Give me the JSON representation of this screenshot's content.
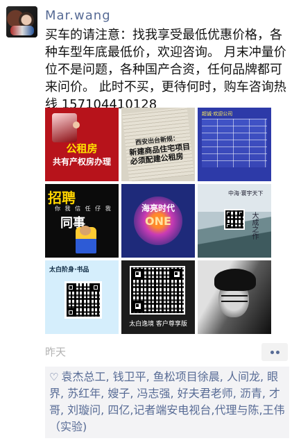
{
  "post": {
    "username": "Mar.wang",
    "content": "买车的请注意：找我享受最低优惠价格，各种车型年底最低价，欢迎咨询。 月末冲量价位不是问题，各种国产合资，任何品牌都可来问价。 此时不买，更待何时，购车咨询热线 15710441012​8",
    "time": "昨天",
    "likes": "袁杰总工, 钱卫平, 鱼松项目徐晨, 人间龙, 眼界, 苏红年, 嫂子, 冯志强, 好夫君老师, 沥青, 才哥, 刘璇问, 四亿,记者端安电视台,代理与陈,王伟（实验)"
  },
  "images": {
    "img1": {
      "line1": "公租房",
      "line2": "共有产权房办理"
    },
    "img2": {
      "headline1": "西安出台新规：",
      "headline2": "新建商品住宅项目\n必须配建公租房"
    },
    "img3": {
      "title": "超诚·欢迎公司"
    },
    "img4": {
      "title": "招聘",
      "sub": "你 我 信 任 仔 我",
      "word": "同事"
    },
    "img5": {
      "line1": "海亮时代",
      "line2": "ONE"
    },
    "img6": {
      "title": "中海·寰宇天下",
      "vertical": "大成之作"
    },
    "img7": {
      "title": "太白阶身·书品"
    },
    "img8": {
      "caption": "太白逸境 客户尊享版"
    }
  },
  "colors": {
    "name_link": "#576b95",
    "time_gray": "#b2b2b2",
    "likes_bg": "#f3f3f5"
  }
}
